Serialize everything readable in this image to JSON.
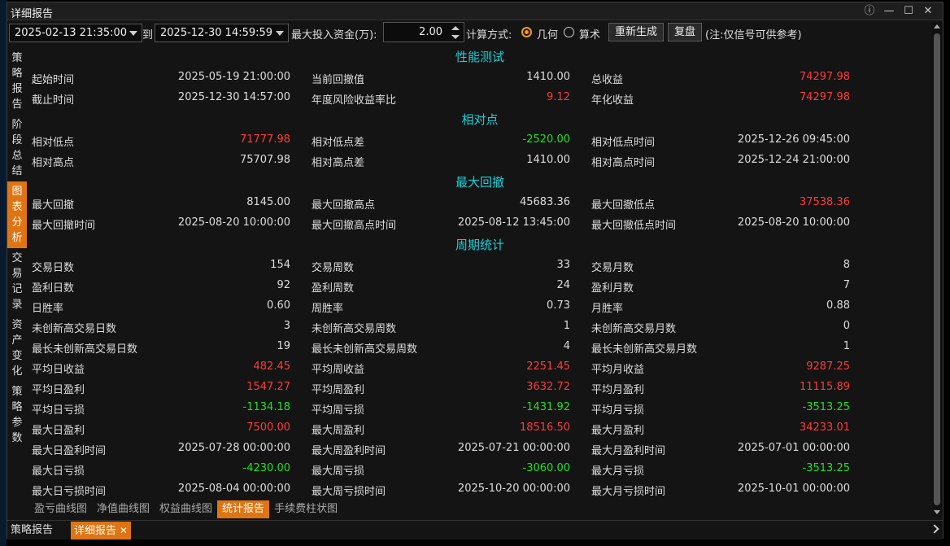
{
  "window": {
    "title": "详细报告"
  },
  "toolbar": {
    "start_time": "2025-02-13 21:35:00",
    "to_label": "到",
    "end_time": "2025-12-30 14:59:59",
    "max_fund_label": "最大投入资金(万):",
    "max_fund_value": "2.00",
    "calc_label": "计算方式:",
    "radio_geometric": "几何",
    "radio_arithmetic": "算术",
    "regenerate_btn": "重新生成",
    "replay_btn": "复盘",
    "note": "(注:仅信号可供参考)"
  },
  "sidebar": {
    "items": [
      {
        "label": "策略报告",
        "active": false
      },
      {
        "label": "阶段总结",
        "active": false
      },
      {
        "label": "图表分析",
        "active": true
      },
      {
        "label": "交易记录",
        "active": false
      },
      {
        "label": "资产变化",
        "active": false
      },
      {
        "label": "策略参数",
        "active": false
      }
    ]
  },
  "sections": {
    "perf": "性能测试",
    "relative": "相对点",
    "drawdown": "最大回撤",
    "period": "周期统计"
  },
  "rows": [
    {
      "sec": "perf",
      "cells": [
        [
          "起始时间",
          "2025-05-19 21:00:00",
          ""
        ],
        [
          "当前回撤值",
          "1410.00",
          ""
        ],
        [
          "总收益",
          "74297.98",
          "red"
        ]
      ]
    },
    {
      "sec": "perf",
      "cells": [
        [
          "截止时间",
          "2025-12-30 14:57:00",
          ""
        ],
        [
          "年度风险收益率比",
          "9.12",
          "red"
        ],
        [
          "年化收益",
          "74297.98",
          "red"
        ]
      ]
    },
    {
      "sec": "relative",
      "cells": [
        [
          "相对低点",
          "71777.98",
          "red"
        ],
        [
          "相对低点差",
          "-2520.00",
          "green"
        ],
        [
          "相对低点时间",
          "2025-12-26 09:45:00",
          ""
        ]
      ]
    },
    {
      "sec": "relative",
      "cells": [
        [
          "相对高点",
          "75707.98",
          ""
        ],
        [
          "相对高点差",
          "1410.00",
          ""
        ],
        [
          "相对高点时间",
          "2025-12-24 21:00:00",
          ""
        ]
      ]
    },
    {
      "sec": "drawdown",
      "cells": [
        [
          "最大回撤",
          "8145.00",
          ""
        ],
        [
          "最大回撤高点",
          "45683.36",
          ""
        ],
        [
          "最大回撤低点",
          "37538.36",
          "red"
        ]
      ]
    },
    {
      "sec": "drawdown",
      "cells": [
        [
          "最大回撤时间",
          "2025-08-20 10:00:00",
          ""
        ],
        [
          "最大回撤高点时间",
          "2025-08-12 13:45:00",
          ""
        ],
        [
          "最大回撤低点时间",
          "2025-08-20 10:00:00",
          ""
        ]
      ]
    },
    {
      "sec": "period",
      "cells": [
        [
          "交易日数",
          "154",
          ""
        ],
        [
          "交易周数",
          "33",
          ""
        ],
        [
          "交易月数",
          "8",
          ""
        ]
      ]
    },
    {
      "sec": "period",
      "cells": [
        [
          "盈利日数",
          "92",
          ""
        ],
        [
          "盈利周数",
          "24",
          ""
        ],
        [
          "盈利月数",
          "7",
          ""
        ]
      ]
    },
    {
      "sec": "period",
      "cells": [
        [
          "日胜率",
          "0.60",
          ""
        ],
        [
          "周胜率",
          "0.73",
          ""
        ],
        [
          "月胜率",
          "0.88",
          ""
        ]
      ]
    },
    {
      "sec": "period",
      "cells": [
        [
          "未创新高交易日数",
          "3",
          ""
        ],
        [
          "未创新高交易周数",
          "1",
          ""
        ],
        [
          "未创新高交易月数",
          "0",
          ""
        ]
      ]
    },
    {
      "sec": "period",
      "cells": [
        [
          "最长未创新高交易日数",
          "19",
          ""
        ],
        [
          "最长未创新高交易周数",
          "4",
          ""
        ],
        [
          "最长未创新高交易月数",
          "1",
          ""
        ]
      ]
    },
    {
      "sec": "period",
      "cells": [
        [
          "平均日收益",
          "482.45",
          "red"
        ],
        [
          "平均周收益",
          "2251.45",
          "red"
        ],
        [
          "平均月收益",
          "9287.25",
          "red"
        ]
      ]
    },
    {
      "sec": "period",
      "cells": [
        [
          "平均日盈利",
          "1547.27",
          "red"
        ],
        [
          "平均周盈利",
          "3632.72",
          "red"
        ],
        [
          "平均月盈利",
          "11115.89",
          "red"
        ]
      ]
    },
    {
      "sec": "period",
      "cells": [
        [
          "平均日亏损",
          "-1134.18",
          "green"
        ],
        [
          "平均周亏损",
          "-1431.92",
          "green"
        ],
        [
          "平均月亏损",
          "-3513.25",
          "green"
        ]
      ]
    },
    {
      "sec": "period",
      "cells": [
        [
          "最大日盈利",
          "7500.00",
          "red"
        ],
        [
          "最大周盈利",
          "18516.50",
          "red"
        ],
        [
          "最大月盈利",
          "34233.01",
          "red"
        ]
      ]
    },
    {
      "sec": "period",
      "cells": [
        [
          "最大日盈利时间",
          "2025-07-28 00:00:00",
          ""
        ],
        [
          "最大周盈利时间",
          "2025-07-21 00:00:00",
          ""
        ],
        [
          "最大月盈利时间",
          "2025-07-01 00:00:00",
          ""
        ]
      ]
    },
    {
      "sec": "period",
      "cells": [
        [
          "最大日亏损",
          "-4230.00",
          "green"
        ],
        [
          "最大周亏损",
          "-3060.00",
          "green"
        ],
        [
          "最大月亏损",
          "-3513.25",
          "green"
        ]
      ]
    },
    {
      "sec": "period",
      "cells": [
        [
          "最大日亏损时间",
          "2025-08-04 00:00:00",
          ""
        ],
        [
          "最大周亏损时间",
          "2025-10-20 00:00:00",
          ""
        ],
        [
          "最大月亏损时间",
          "2025-10-01 00:00:00",
          ""
        ]
      ]
    }
  ],
  "chart_tabs": [
    {
      "label": "盈亏曲线图",
      "active": false
    },
    {
      "label": "净值曲线图",
      "active": false
    },
    {
      "label": "权益曲线图",
      "active": false
    },
    {
      "label": "统计报告",
      "active": true
    },
    {
      "label": "手续费柱状图",
      "active": false
    }
  ],
  "bottom_tabs": [
    {
      "label": "策略报告",
      "active": false
    },
    {
      "label": "详细报告",
      "active": true,
      "closable": true
    }
  ],
  "colors": {
    "accent": "#e07412",
    "section": "#19d0d8",
    "positive": "#ff3b3b",
    "negative": "#22e022"
  }
}
